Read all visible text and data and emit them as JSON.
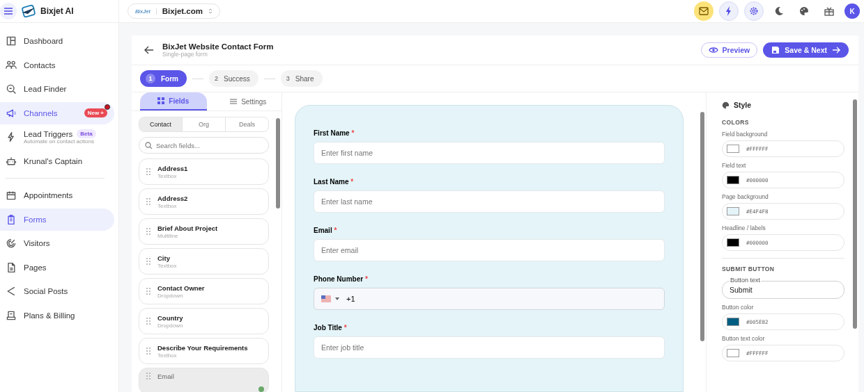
{
  "app": {
    "name": "Bixjet AI"
  },
  "workspace": {
    "logo_text": "BixJet",
    "name": "Bixjet.com"
  },
  "topbar": {
    "avatar": "K"
  },
  "sidebar": {
    "groups": [
      {
        "items": [
          {
            "label": "Dashboard",
            "selected": false
          },
          {
            "label": "Contacts",
            "selected": false
          },
          {
            "label": "Lead Finder",
            "selected": false
          },
          {
            "label": "Channels",
            "selected": true,
            "badge": {
              "label": "New +",
              "kind": "new"
            },
            "dot": true
          },
          {
            "label": "Lead Triggers",
            "selected": false,
            "badge": {
              "label": "Beta",
              "kind": "beta"
            },
            "subtitle": "Automate on contact actions"
          },
          {
            "label": "Krunal's Captain",
            "selected": false
          }
        ]
      },
      {
        "items": [
          {
            "label": "Appointments",
            "selected": false
          },
          {
            "label": "Forms",
            "selected": true
          },
          {
            "label": "Visitors",
            "selected": false
          },
          {
            "label": "Pages",
            "selected": false
          },
          {
            "label": "Social Posts",
            "selected": false
          },
          {
            "label": "Plans & Billing",
            "selected": false
          }
        ]
      }
    ]
  },
  "header": {
    "title": "BixJet Website Contact Form",
    "subtitle": "Single-page form",
    "preview": "Preview",
    "save": "Save & Next"
  },
  "steps": [
    {
      "number": "1",
      "label": "Form",
      "selected": true
    },
    {
      "number": "2",
      "label": "Success",
      "selected": false
    },
    {
      "number": "3",
      "label": "Share",
      "selected": false
    }
  ],
  "panel_tabs": [
    {
      "label": "Fields",
      "selected": true
    },
    {
      "label": "Settings",
      "selected": false
    }
  ],
  "segments": [
    {
      "label": "Contact",
      "selected": true
    },
    {
      "label": "Org",
      "selected": false
    },
    {
      "label": "Deals",
      "selected": false
    }
  ],
  "search": {
    "placeholder": "Search fields..."
  },
  "field_items": [
    {
      "name": "Address1",
      "type": "Textbox",
      "added": false
    },
    {
      "name": "Address2",
      "type": "Textbox",
      "added": false
    },
    {
      "name": "Brief About Project",
      "type": "Multiline",
      "added": false
    },
    {
      "name": "City",
      "type": "Textbox",
      "added": false
    },
    {
      "name": "Contact Owner",
      "type": "Dropdown",
      "added": false
    },
    {
      "name": "Country",
      "type": "Dropdown",
      "added": false
    },
    {
      "name": "Describe Your Requirements",
      "type": "Textbox",
      "added": false
    },
    {
      "name": "Email",
      "added": true
    }
  ],
  "form_fields": [
    {
      "label": "First Name",
      "required_mark": "*",
      "kind": "text",
      "placeholder": "Enter first name"
    },
    {
      "label": "Last Name",
      "required_mark": "*",
      "kind": "text",
      "placeholder": "Enter last name"
    },
    {
      "label": "Email",
      "required_mark": "*",
      "kind": "text",
      "placeholder": "Enter email"
    },
    {
      "label": "Phone Number",
      "required_mark": "*",
      "kind": "phone",
      "value": "+1"
    },
    {
      "label": "Job Title",
      "required_mark": "*",
      "kind": "text",
      "placeholder": "Enter job title"
    }
  ],
  "style_panel": {
    "title": "Style",
    "colors_heading": "COLORS",
    "colors": [
      {
        "label": "Field background",
        "value": "#FFFFFF",
        "color": "#ffffff"
      },
      {
        "label": "Field text",
        "value": "#000000",
        "color": "#000000"
      },
      {
        "label": "Page background",
        "value": "#E4F4F8",
        "color": "#e4f4f8"
      },
      {
        "label": "Headline / labels",
        "value": "#000000",
        "color": "#000000"
      }
    ],
    "submit_heading": "SUBMIT BUTTON",
    "button_text": {
      "label": "Button text",
      "value": "Submit"
    },
    "button_colors": [
      {
        "label": "Button color",
        "value": "#005E82",
        "color": "#005e82"
      },
      {
        "label": "Button text color",
        "value": "#FFFFFF",
        "color": "#ffffff"
      }
    ]
  }
}
